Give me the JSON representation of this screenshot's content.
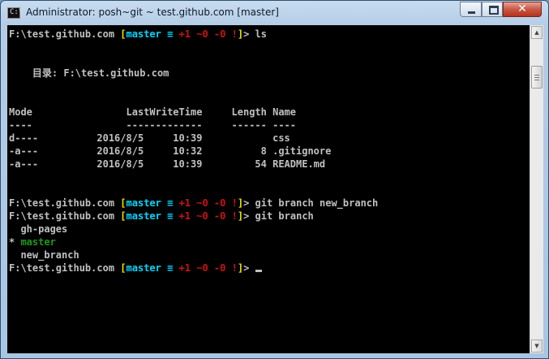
{
  "window": {
    "title": "Administrator: posh~git ~ test.github.com [master]",
    "icon_text": "C:\\",
    "close_glyph": "✕"
  },
  "prompt": {
    "path": "F:\\test.github.com ",
    "branch_open": "[",
    "branch": "master",
    "sync": " ≡ ",
    "added": "+1",
    "modified": " ~0",
    "deleted": " -0",
    "conflict": " !",
    "branch_close": "]",
    "suffix": "> "
  },
  "console": {
    "cmd1": "ls",
    "dir_header": "    目录: F:\\test.github.com",
    "col_header": "Mode                LastWriteTime     Length Name",
    "col_rule": "----                -------------     ------ ----",
    "rows": [
      "d----          2016/8/5     10:39            css",
      "-a---          2016/8/5     10:32          8 .gitignore",
      "-a---          2016/8/5     10:39         54 README.md"
    ],
    "cmd2": "git branch new_branch",
    "cmd3": "git branch",
    "branch_list": {
      "b1": "  gh-pages",
      "current_marker": "* ",
      "current": "master",
      "b3": "  new_branch"
    }
  },
  "colors": {
    "console_bg": "#000000",
    "text": "#c0c0c0",
    "branch": "#00d7ff",
    "bracket": "#e8e800",
    "status": "#cc1414",
    "current_branch": "#1a9a1a"
  }
}
